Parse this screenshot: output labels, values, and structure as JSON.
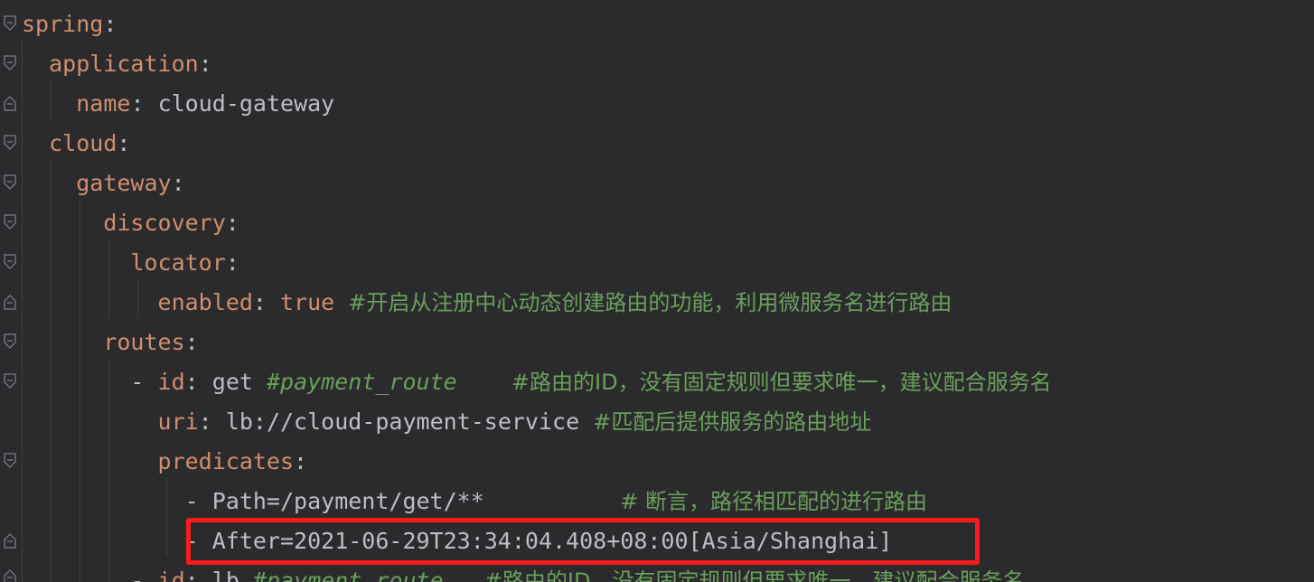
{
  "editor": {
    "language": "yaml",
    "colors": {
      "background": "#2b2b2d",
      "key": "#cf8e6d",
      "text": "#bcbec4",
      "comment": "#6a9f5b",
      "highlight_box": "#ff1a1a"
    },
    "lines": {
      "l1": {
        "key": "spring",
        "colon": ":"
      },
      "l2": {
        "key": "application",
        "colon": ":"
      },
      "l3": {
        "key": "name",
        "colon": ":",
        "value": "cloud-gateway"
      },
      "l4": {
        "key": "cloud",
        "colon": ":"
      },
      "l5": {
        "key": "gateway",
        "colon": ":"
      },
      "l6": {
        "key": "discovery",
        "colon": ":"
      },
      "l7": {
        "key": "locator",
        "colon": ":"
      },
      "l8": {
        "key": "enabled",
        "colon": ":",
        "value": "true",
        "comment": "#开启从注册中心动态创建路由的功能，利用微服务名进行路由"
      },
      "l9": {
        "key": "routes",
        "colon": ":"
      },
      "l10": {
        "dash": "- ",
        "key": "id",
        "colon": ":",
        "value": "get",
        "comment1": "#payment_route",
        "comment2": "#路由的ID，没有固定规则但要求唯一，建议配合服务名"
      },
      "l11": {
        "key": "uri",
        "colon": ":",
        "value": "lb://cloud-payment-service",
        "comment": "#匹配后提供服务的路由地址"
      },
      "l12": {
        "key": "predicates",
        "colon": ":"
      },
      "l13": {
        "item": "- Path=/payment/get/**",
        "comment": "# 断言，路径相匹配的进行路由"
      },
      "l14": {
        "item": "- After=2021-06-29T23:34:04.408+08:00[Asia/Shanghai]"
      },
      "l15": {
        "dash": "- ",
        "key": "id",
        "colon": ":",
        "value": "lb",
        "comment1": "#payment_route",
        "comment2": "#路由的ID，没有固定规则但要求唯一，建议配合服务名"
      }
    }
  }
}
